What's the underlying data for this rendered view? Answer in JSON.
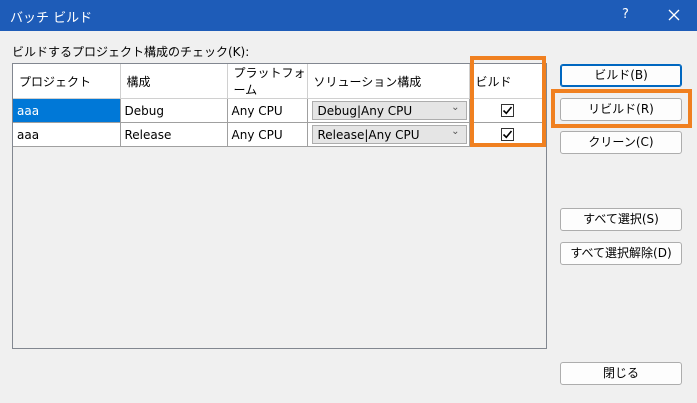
{
  "window": {
    "title": "バッチ ビルド",
    "help_label": "?"
  },
  "caption": "ビルドするプロジェクト構成のチェック(K):",
  "table": {
    "headers": [
      "プロジェクト",
      "構成",
      "プラットフォーム",
      "ソリューション構成",
      "ビルド"
    ],
    "rows": [
      {
        "project": "aaa",
        "config": "Debug",
        "platform": "Any CPU",
        "solution_config": "Debug|Any CPU",
        "build": true
      },
      {
        "project": "aaa",
        "config": "Release",
        "platform": "Any CPU",
        "solution_config": "Release|Any CPU",
        "build": true
      }
    ]
  },
  "buttons": {
    "build": "ビルド(B)",
    "rebuild": "リビルド(R)",
    "clean": "クリーン(C)",
    "select_all": "すべて選択(S)",
    "deselect_all": "すべて選択解除(D)",
    "close": "閉じる"
  },
  "colors": {
    "titlebar": "#1e5cb8",
    "selection": "#0078d7",
    "highlight": "#f08020"
  }
}
